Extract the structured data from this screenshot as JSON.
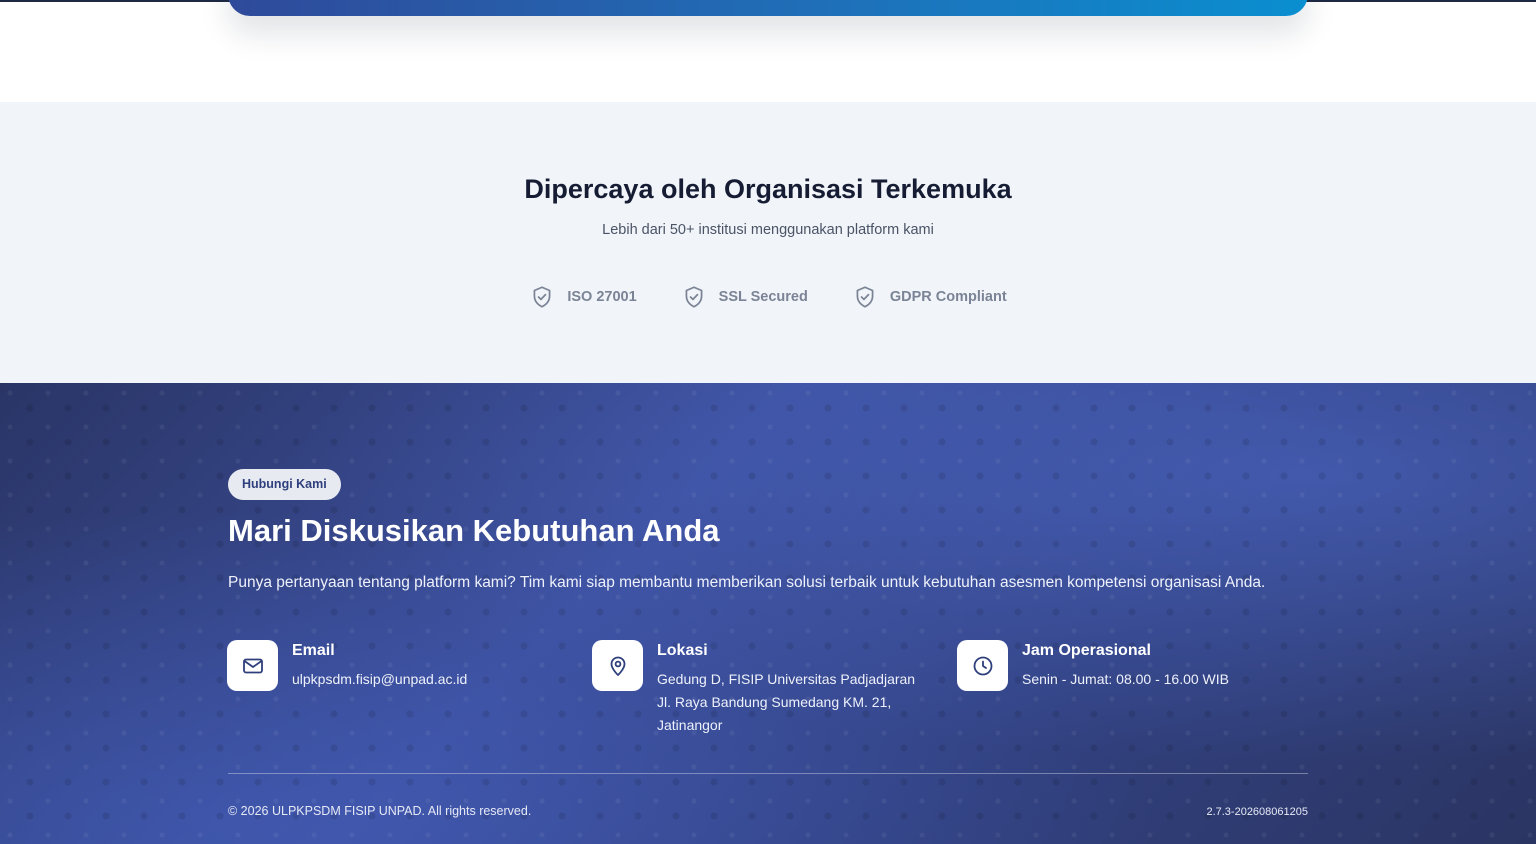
{
  "trust": {
    "title": "Dipercaya oleh Organisasi Terkemuka",
    "subtitle": "Lebih dari 50+ institusi menggunakan platform kami",
    "badges": [
      {
        "icon": "shield-check-icon",
        "label": "ISO 27001"
      },
      {
        "icon": "shield-check-icon",
        "label": "SSL Secured"
      },
      {
        "icon": "shield-check-icon",
        "label": "GDPR Compliant"
      }
    ]
  },
  "contact": {
    "pill": "Hubungi Kami",
    "title": "Mari Diskusikan Kebutuhan Anda",
    "description": "Punya pertanyaan tentang platform kami? Tim kami siap membantu memberikan solusi terbaik untuk kebutuhan asesmen kompetensi organisasi Anda.",
    "items": [
      {
        "icon": "mail-icon",
        "title": "Email",
        "lines": [
          "ulpkpsdm.fisip@unpad.ac.id"
        ]
      },
      {
        "icon": "map-pin-icon",
        "title": "Lokasi",
        "lines": [
          "Gedung D, FISIP Universitas Padjadjaran",
          "Jl. Raya Bandung Sumedang KM. 21,",
          "Jatinangor"
        ]
      },
      {
        "icon": "clock-icon",
        "title": "Jam Operasional",
        "lines": [
          "Senin - Jumat: 08.00 - 16.00 WIB"
        ]
      }
    ]
  },
  "footer": {
    "copyright": "© 2026 ULPKPSDM FISIP UNPAD. All rights reserved.",
    "version": "2.7.3-202608061205"
  },
  "colors": {
    "accent": "#2e3f7c",
    "contact_bg": "#3c4f9c",
    "trust_bg": "#f1f4f8"
  }
}
